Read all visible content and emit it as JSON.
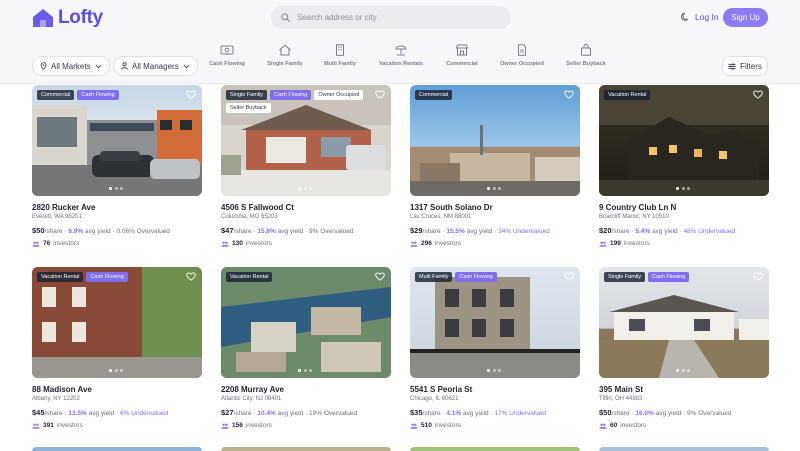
{
  "brand": {
    "name": "Lofty",
    "accent": "#5b4fe0"
  },
  "search": {
    "placeholder": "Search address or city"
  },
  "header": {
    "login": "Log In",
    "signup": "Sign Up",
    "theme_icon": "moon-icon"
  },
  "filters": {
    "markets": "All Markets",
    "managers": "All Managers",
    "filters_label": "Filters",
    "categories": [
      {
        "label": "Cash Flowing",
        "icon": "cash-icon"
      },
      {
        "label": "Single Family",
        "icon": "house-icon"
      },
      {
        "label": "Multi Family",
        "icon": "building-icon"
      },
      {
        "label": "Vacation Rentals",
        "icon": "umbrella-icon"
      },
      {
        "label": "Commercial",
        "icon": "store-icon"
      },
      {
        "label": "Owner Occupied",
        "icon": "document-icon"
      },
      {
        "label": "Seller Buyback",
        "icon": "bag-icon"
      }
    ]
  },
  "listings": [
    {
      "tags": [
        "Commercial",
        "Cash Flowing"
      ],
      "address": "2820 Rucker Ave",
      "city": "Everett, WA 98201",
      "price": "$50",
      "share": "/share · ",
      "yield": "6.9%",
      "yield_label": " avg yield · ",
      "valuation": "0.06% Overvalued",
      "under": false,
      "investors": "76",
      "inv_label": "investors"
    },
    {
      "tags": [
        "Single Family",
        "Cash Flowing",
        "Owner Occupied",
        "Seller Buyback"
      ],
      "address": "4506 S Fallwood Ct",
      "city": "Columbia, MO 65203",
      "price": "$47",
      "share": "/share · ",
      "yield": "15.6%",
      "yield_label": " avg yield · ",
      "valuation": "9% Overvalued",
      "under": false,
      "investors": "130",
      "inv_label": "investors"
    },
    {
      "tags": [
        "Commercial"
      ],
      "address": "1317 South Solano Dr",
      "city": "Las Cruces, NM 88001",
      "price": "$29",
      "share": "/share · ",
      "yield": "15.5%",
      "yield_label": " avg yield · ",
      "valuation": "34% Undervalued",
      "under": true,
      "investors": "296",
      "inv_label": "investors"
    },
    {
      "tags": [
        "Vacation Rental"
      ],
      "address": "9 Country Club Ln N",
      "city": "Briarcliff Manor, NY 10510",
      "price": "$20",
      "share": "/share · ",
      "yield": "5.4%",
      "yield_label": " avg yield · ",
      "valuation": "48% Undervalued",
      "under": true,
      "investors": "199",
      "inv_label": "investors"
    },
    {
      "tags": [
        "Vacation Rental",
        "Cash Flowing"
      ],
      "address": "88 Madison Ave",
      "city": "Albany, NY 12202",
      "price": "$45",
      "share": "/share · ",
      "yield": "13.5%",
      "yield_label": " avg yield · ",
      "valuation": "6% Undervalued",
      "under": true,
      "investors": "391",
      "inv_label": "investors"
    },
    {
      "tags": [
        "Vacation Rental"
      ],
      "address": "2208 Murray Ave",
      "city": "Atlantic City, NJ 08401",
      "price": "$27",
      "share": "/share · ",
      "yield": "10.4%",
      "yield_label": " avg yield · ",
      "valuation": "19% Overvalued",
      "under": false,
      "investors": "156",
      "inv_label": "investors"
    },
    {
      "tags": [
        "Multi Family",
        "Cash Flowing"
      ],
      "address": "5541 S Peoria St",
      "city": "Chicago, IL 60621",
      "price": "$35",
      "share": "/share · ",
      "yield": "4.1%",
      "yield_label": " avg yield · ",
      "valuation": "17% Undervalued",
      "under": true,
      "investors": "510",
      "inv_label": "investors"
    },
    {
      "tags": [
        "Single Family",
        "Cash Flowing"
      ],
      "address": "395 Main St",
      "city": "Tiffin, OH 44883",
      "price": "$50",
      "share": "/share · ",
      "yield": "16.0%",
      "yield_label": " avg yield · ",
      "valuation": "9% Overvalued",
      "under": false,
      "investors": "60",
      "inv_label": "investors"
    }
  ]
}
